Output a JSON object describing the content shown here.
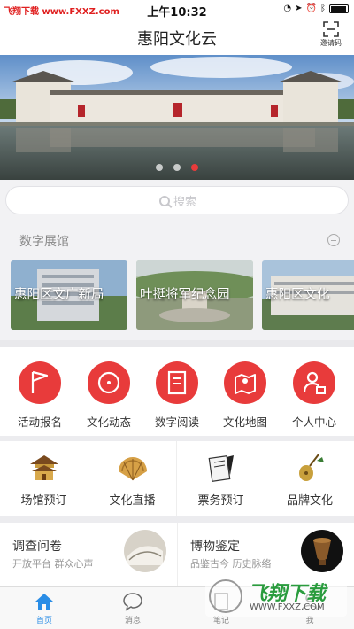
{
  "status_bar": {
    "watermark": "飞翔下载 www.FXXZ.com",
    "time": "上午10:32"
  },
  "header": {
    "title": "惠阳文化云",
    "invite_label": "邀请码"
  },
  "banner": {
    "slides": 3,
    "active_slide": 3
  },
  "search": {
    "placeholder": "搜索"
  },
  "digital_hall": {
    "title": "数字展馆",
    "items": [
      {
        "label": "惠阳区文广新局"
      },
      {
        "label": "叶挺将军纪念园"
      },
      {
        "label": "惠阳区文化"
      }
    ]
  },
  "functions": [
    {
      "label": "活动报名",
      "icon": "flag-icon"
    },
    {
      "label": "文化动态",
      "icon": "news-icon"
    },
    {
      "label": "数字阅读",
      "icon": "book-icon"
    },
    {
      "label": "文化地图",
      "icon": "map-icon"
    },
    {
      "label": "个人中心",
      "icon": "user-icon"
    }
  ],
  "services": [
    {
      "label": "场馆预订",
      "icon": "pavilion-icon"
    },
    {
      "label": "文化直播",
      "icon": "fan-icon"
    },
    {
      "label": "票务预订",
      "icon": "ticket-icon"
    },
    {
      "label": "品牌文化",
      "icon": "lute-icon"
    }
  ],
  "promos": [
    {
      "title": "调查问卷",
      "subtitle": "开放平台 群众心声"
    },
    {
      "title": "博物鉴定",
      "subtitle": "品鉴古今 历史脉络"
    }
  ],
  "tabbar": [
    {
      "label": "首页",
      "active": true
    },
    {
      "label": "消息",
      "active": false
    },
    {
      "label": "笔记",
      "active": false
    },
    {
      "label": "我",
      "active": false
    }
  ],
  "watermark": {
    "title": "飞翔下载",
    "url": "WWW.FXXZ.COM"
  },
  "colors": {
    "accent_red": "#e83b3b",
    "tab_active": "#2a8de6"
  }
}
